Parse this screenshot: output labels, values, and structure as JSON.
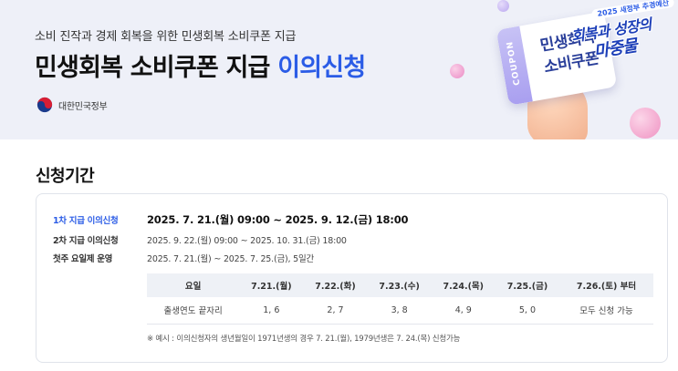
{
  "hero": {
    "subtitle": "소비 진작과 경제 회복을 위한 민생회복 소비쿠폰 지급",
    "title_main": "민생회복 소비쿠폰 지급 ",
    "title_accent": "이의신청",
    "gov_name": "대한민국정부",
    "coupon_side": "COUPON",
    "coupon_line1": "민생회복",
    "coupon_line2": "소비쿠폰",
    "badge_tag": "2025 새정부 추경예산",
    "badge_line1": "회복과 성장의",
    "badge_line2": "마중물"
  },
  "section": {
    "title": "신청기간"
  },
  "periods": [
    {
      "label": "1차 지급 이의신청",
      "value": "2025. 7. 21.(월) 09:00 ~ 2025. 9. 12.(금) 18:00"
    },
    {
      "label": "2차 지급 이의신청",
      "value": "2025. 9. 22.(월) 09:00 ~ 2025. 10. 31.(금) 18:00"
    },
    {
      "label": "첫주 요일제 운영",
      "value": "2025. 7. 21.(월) ~ 2025. 7. 25.(금), 5일간"
    }
  ],
  "rotation_table": {
    "headers": [
      "요일",
      "7.21.(월)",
      "7.22.(화)",
      "7.23.(수)",
      "7.24.(목)",
      "7.25.(금)",
      "7.26.(토) 부터"
    ],
    "row": [
      "출생연도 끝자리",
      "1, 6",
      "2, 7",
      "3, 8",
      "4, 9",
      "5, 0",
      "모두 신청 가능"
    ]
  },
  "note": "※ 예시 : 이의신청자의 생년월일이 1971년생의 경우 7. 21.(월), 1979년생은 7. 24.(목) 신청가능",
  "colors": {
    "accent": "#2b5ce6",
    "hero_bg": "#eef0f8",
    "table_header_bg": "#eef1f6"
  }
}
